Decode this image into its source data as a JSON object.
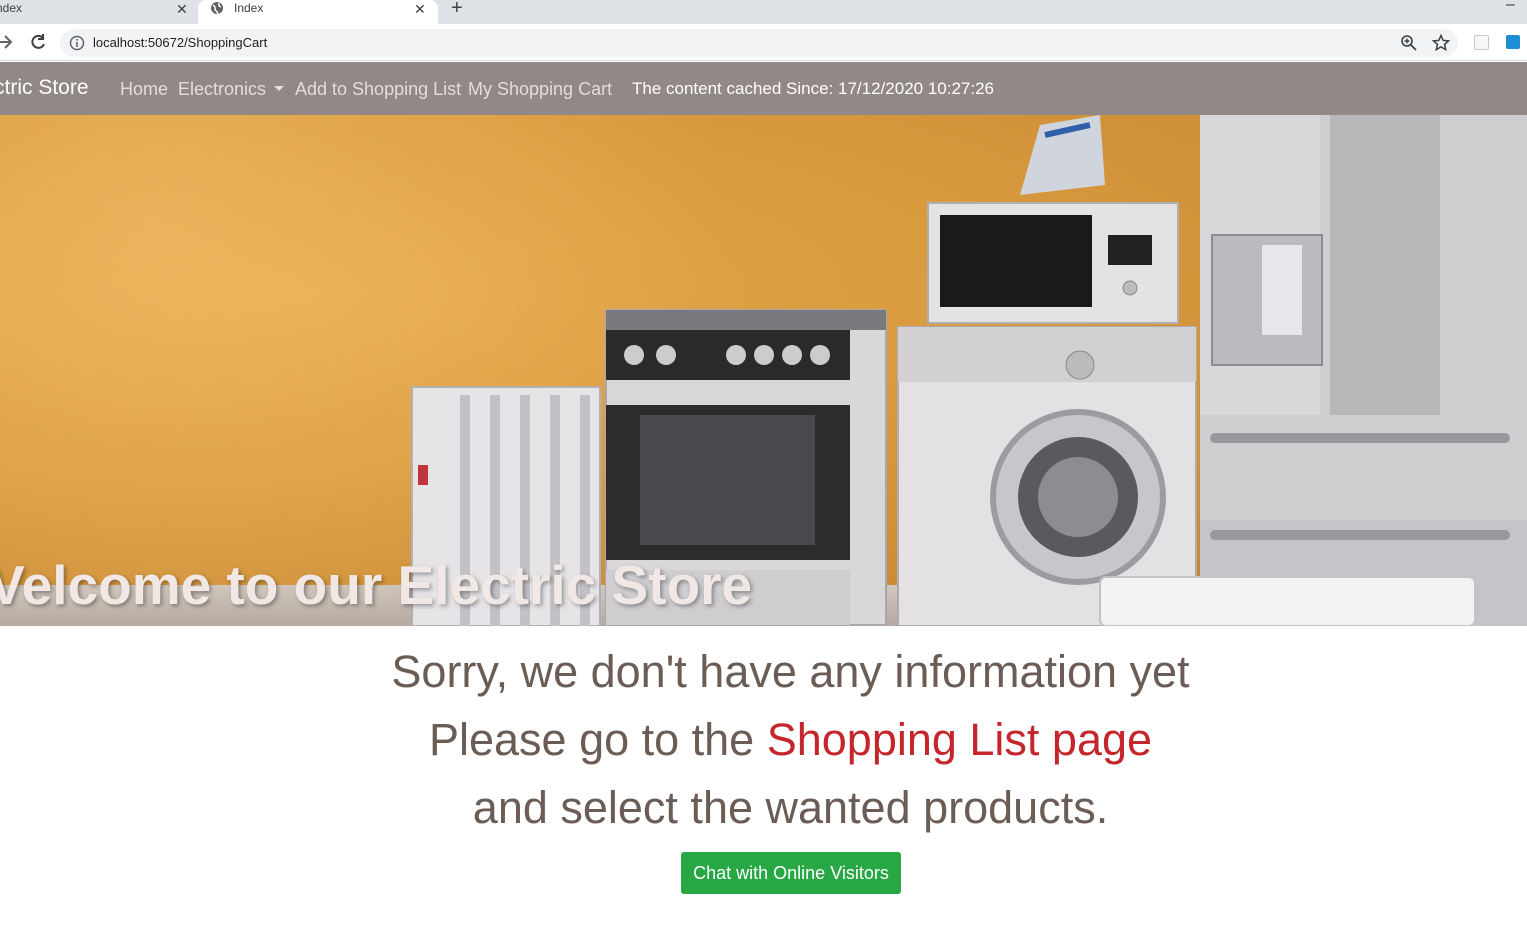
{
  "browser": {
    "tabs": [
      {
        "title": "ndex",
        "close": "✕"
      },
      {
        "title": "Index",
        "close": "✕"
      }
    ],
    "new_tab": "+",
    "minimize": "–",
    "url": "localhost:50672/ShoppingCart"
  },
  "navbar": {
    "brand": "ctric Store",
    "links": {
      "home": "Home",
      "electronics": "Electronics",
      "add": "Add to Shopping List",
      "cart": "My Shopping Cart"
    },
    "cache_text": "The content cached Since: 17/12/2020 10:27:26"
  },
  "hero": {
    "title": "Velcome to our Electric Store"
  },
  "message": {
    "line1": "Sorry, we don't have any information yet",
    "line2_prefix": "Please go to the ",
    "line2_link": "Shopping List page",
    "line3": "and select the wanted products."
  },
  "chat_button": "Chat with Online Visitors",
  "colors": {
    "navbar": "#928886",
    "link_red": "#c5262b",
    "button_green": "#28a745",
    "message_text": "#6b5d55"
  }
}
